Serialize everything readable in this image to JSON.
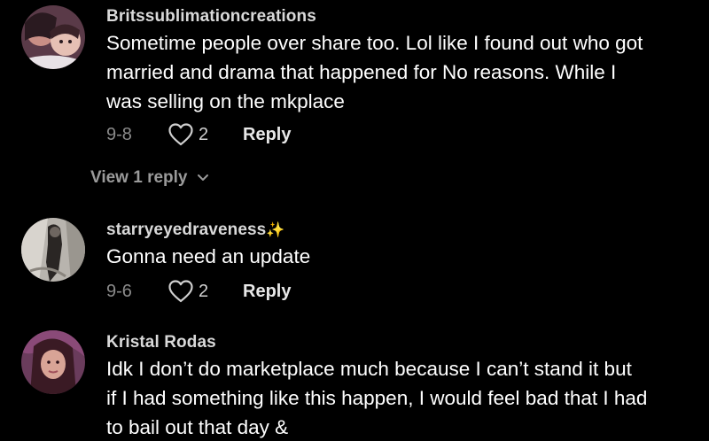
{
  "comments": [
    {
      "username": "Britssublimationcreations",
      "text_lines": [
        "Sometime people over share too. Lol like I found out who got",
        "married and drama that happened for No reasons. While I",
        "was selling on the mkplace"
      ],
      "date": "9-8",
      "likes": "2",
      "reply_label": "Reply",
      "view_replies_label": "View 1 reply"
    },
    {
      "username": "starryeyedraveness",
      "username_emoji": "✨",
      "text_lines": [
        "Gonna need an update"
      ],
      "date": "9-6",
      "likes": "2",
      "reply_label": "Reply"
    },
    {
      "username": "Kristal Rodas",
      "text_lines": [
        "Idk I don’t do marketplace much because I can’t stand it but",
        "if I had something like this happen, I would feel bad that I had",
        "to bail out that day &"
      ]
    }
  ],
  "icons": {
    "like": "heart-outline-icon",
    "expand": "chevron-down-icon"
  },
  "colors": {
    "background": "#000000",
    "username": "#d9d9d9",
    "meta": "#8a8a8a",
    "text": "#ffffff"
  }
}
